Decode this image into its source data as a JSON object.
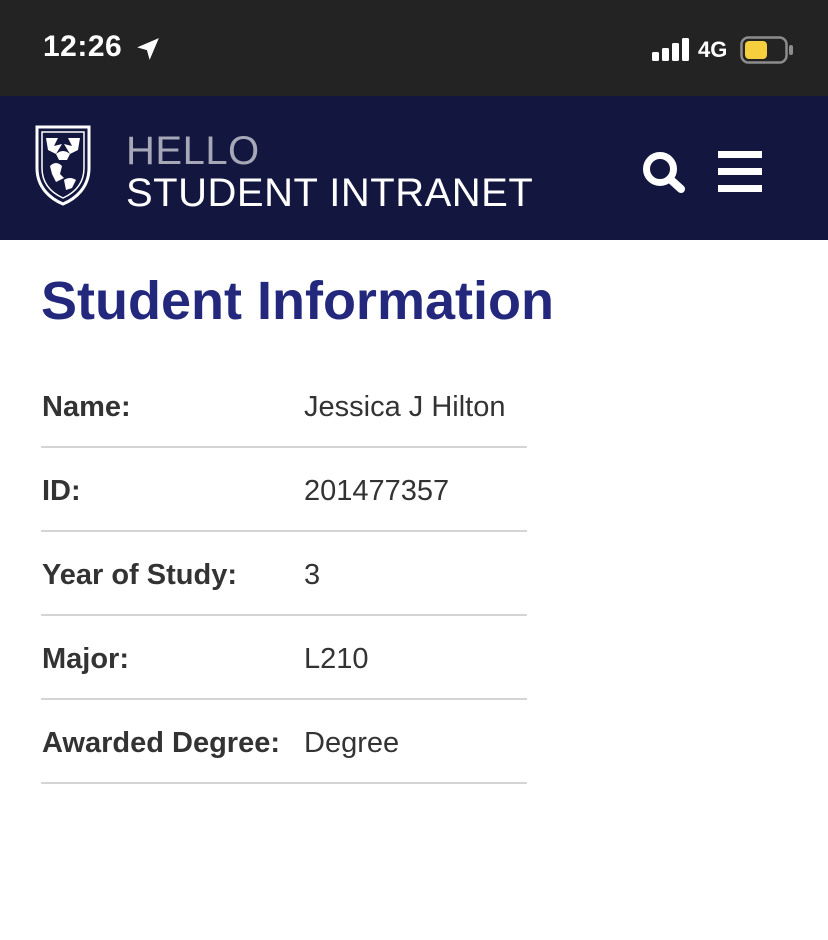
{
  "status_bar": {
    "time": "12:26",
    "network": "4G",
    "battery_color": "#f5cf3d",
    "icons": [
      "location-arrow-icon",
      "signal-bars-icon",
      "battery-icon"
    ]
  },
  "header": {
    "hello": "HELLO",
    "title": "STUDENT INTRANET",
    "background_color": "#13163e",
    "icons": [
      "crest-icon",
      "search-icon",
      "menu-icon"
    ]
  },
  "page": {
    "title": "Student Information",
    "title_color": "#23287c"
  },
  "info": [
    {
      "label": "Name:",
      "value": "Jessica J Hilton"
    },
    {
      "label": "ID:",
      "value": "201477357"
    },
    {
      "label": "Year of Study:",
      "value": "3"
    },
    {
      "label": "Major:",
      "value": "L210"
    },
    {
      "label": "Awarded Degree:",
      "value": "Degree"
    }
  ]
}
